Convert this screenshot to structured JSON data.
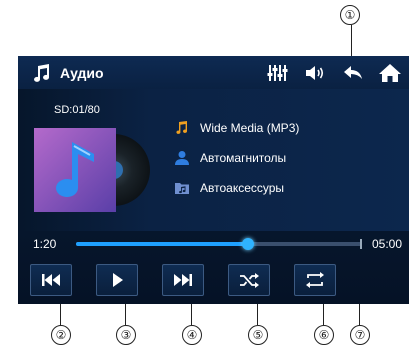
{
  "callouts": [
    "①",
    "②",
    "③",
    "④",
    "⑤",
    "⑥",
    "⑦"
  ],
  "header": {
    "title": "Аудио"
  },
  "track_info": {
    "sd_label": "SD:01/80",
    "file": "Wide Media (MP3)",
    "artist": "Автомагнитолы",
    "album": "Автоаксессуры"
  },
  "progress": {
    "elapsed": "1:20",
    "total": "05:00",
    "value": 0.6
  },
  "icons": {
    "header": [
      "music-note-icon",
      "equalizer-icon",
      "volume-icon",
      "back-arrow-icon",
      "home-icon"
    ],
    "rows": [
      "music-note-icon",
      "person-icon",
      "folder-music-icon"
    ],
    "controls": [
      "previous-icon",
      "play-icon",
      "next-icon",
      "shuffle-icon",
      "repeat-icon"
    ]
  },
  "colors": {
    "accent": "#1ea0ff",
    "background": "#0a1f3d",
    "note": "#f0a020",
    "person": "#2f7de0"
  }
}
